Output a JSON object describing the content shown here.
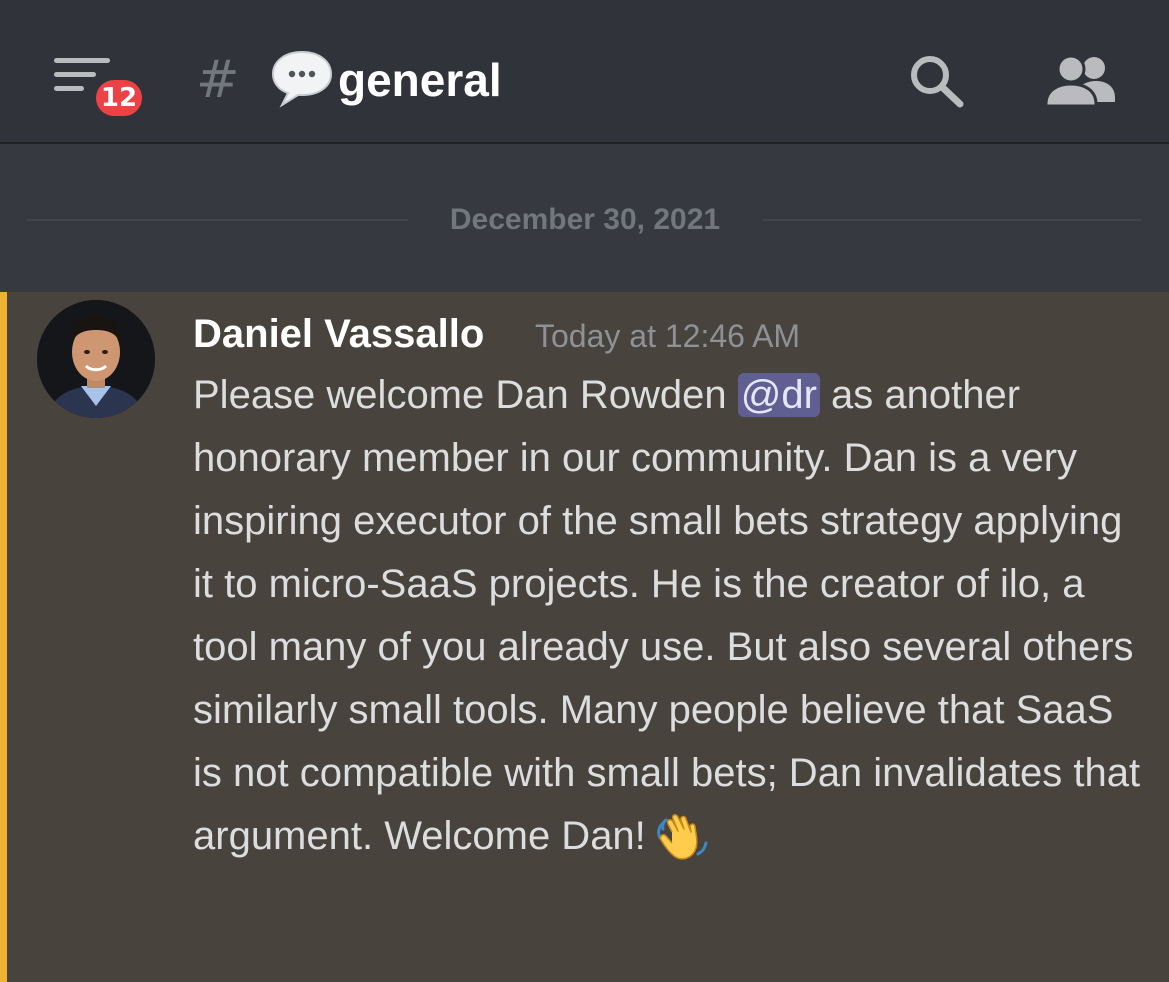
{
  "header": {
    "badge_count": "12",
    "hash_symbol": "#",
    "channel_name": "general",
    "icons": {
      "menu": "hamburger-menu-icon",
      "channel_emoji": "speech-bubble-icon",
      "search": "search-icon",
      "members": "members-icon"
    }
  },
  "date_divider": "December 30, 2021",
  "message": {
    "author": "Daniel Vassallo",
    "timestamp": "Today at 12:46 AM",
    "text_before_mention": "Please welcome Dan Rowden ",
    "mention": "@dr",
    "text_after_mention": " as another honorary member in our community. Dan is a very inspiring executor of the small bets strategy applying it to micro-SaaS projects. He is the creator of ilo, a tool many of you already use. But also several others similarly small tools. Many people believe that SaaS is not compatible with small bets; Dan invalidates that argument. Welcome Dan!",
    "emoji": "waving-hand-icon"
  },
  "colors": {
    "header_bg": "#303339",
    "chat_bg": "#36393f",
    "highlight_bg": "#48433d",
    "highlight_border": "#f0b232",
    "badge": "#ed4245",
    "mention_bg": "#5f5f91"
  }
}
